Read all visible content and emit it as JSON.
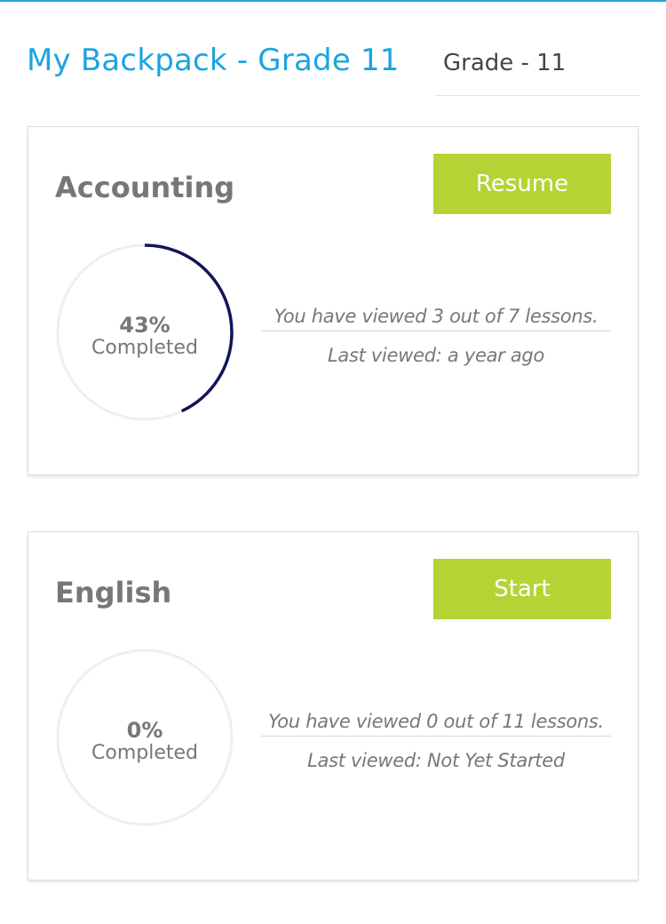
{
  "header": {
    "title": "My Backpack - Grade 11",
    "grade_select": "Grade - 11"
  },
  "courses": [
    {
      "name": "Accounting",
      "action_label": "Resume",
      "progress_percent": 43,
      "progress_text": "43%",
      "progress_label": "Completed",
      "viewed_text": "You have viewed 3 out of 7 lessons.",
      "last_viewed_text": "Last viewed: a year ago"
    },
    {
      "name": "English",
      "action_label": "Start",
      "progress_percent": 0,
      "progress_text": "0%",
      "progress_label": "Completed",
      "viewed_text": "You have viewed 0 out of 11 lessons.",
      "last_viewed_text": "Last viewed: Not Yet Started"
    }
  ],
  "colors": {
    "title": "#1ba4e0",
    "button": "#b5d334",
    "progress_arc": "#12145a",
    "progress_track": "#efefef"
  }
}
